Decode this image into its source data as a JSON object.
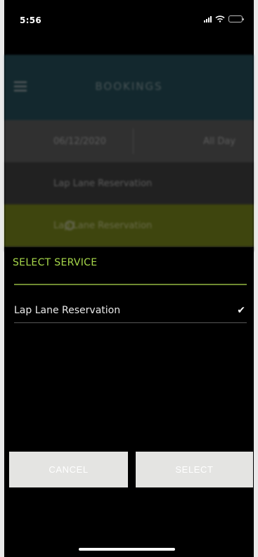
{
  "status_bar": {
    "time": "5:56"
  },
  "background_app": {
    "title": "BOOKINGS",
    "date": "06/12/2020",
    "time_range": "All Day",
    "service_row": "Lap Lane Reservation",
    "highlight_row": "Lap Lane Reservation"
  },
  "sheet": {
    "title": "SELECT SERVICE",
    "options": [
      {
        "label": "Lap Lane Reservation",
        "selected": true
      }
    ],
    "cancel_label": "CANCEL",
    "select_label": "SELECT"
  },
  "colors": {
    "accent_green": "#a7d84a",
    "button_bg": "#e4e4e2",
    "header_teal": "#2b5a66"
  }
}
